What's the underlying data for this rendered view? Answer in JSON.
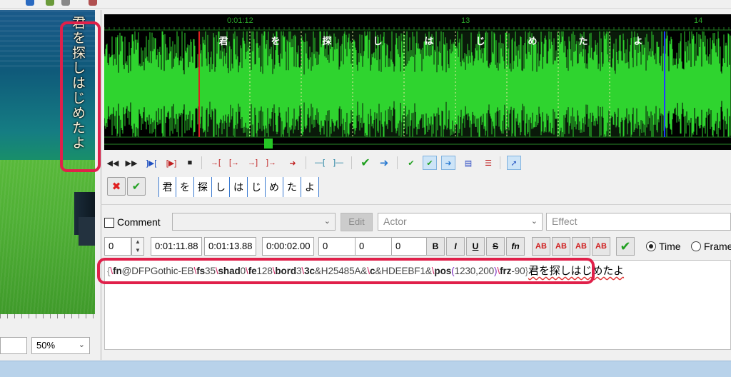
{
  "video": {
    "subtitle_vertical": "君を探しはじめたよ",
    "zoom": "50%"
  },
  "audio": {
    "time_markers": [
      "0:01:12",
      "13",
      "14"
    ],
    "syllables": [
      "君",
      "を",
      "探",
      "し",
      "は",
      "じ",
      "め",
      "た",
      "よ"
    ]
  },
  "karaoke": {
    "cancel_icon": "cancel-icon",
    "accept_icon": "accept-icon",
    "syllables": [
      "君",
      "を",
      "探",
      "し",
      "は",
      "じ",
      "め",
      "た",
      "よ"
    ]
  },
  "editor": {
    "comment_label": "Comment",
    "style_value": "",
    "edit_label": "Edit",
    "actor_placeholder": "Actor",
    "effect_placeholder": "Effect",
    "layer": "0",
    "start_time": "0:01:11.88",
    "end_time": "0:01:13.88",
    "duration": "0:00:02.00",
    "margin_l": "0",
    "margin_r": "0",
    "margin_v": "0",
    "fmt_bold": "B",
    "fmt_italic": "I",
    "fmt_underline": "U",
    "fmt_strike": "S",
    "fmt_font": "fn",
    "color_label": "AB",
    "time_label": "Time",
    "frame_label": "Frame"
  },
  "text": {
    "parts": [
      {
        "c": "br",
        "t": "{"
      },
      {
        "c": "bs",
        "t": "\\"
      },
      {
        "c": "tag",
        "t": "fn"
      },
      {
        "c": "val",
        "t": "@DFPGothic-EB"
      },
      {
        "c": "bs",
        "t": "\\"
      },
      {
        "c": "tag",
        "t": "fs"
      },
      {
        "c": "val",
        "t": "35"
      },
      {
        "c": "bs",
        "t": "\\"
      },
      {
        "c": "tag",
        "t": "shad"
      },
      {
        "c": "val",
        "t": "0"
      },
      {
        "c": "bs",
        "t": "\\"
      },
      {
        "c": "tag",
        "t": "fe"
      },
      {
        "c": "val",
        "t": "128"
      },
      {
        "c": "bs",
        "t": "\\"
      },
      {
        "c": "tag",
        "t": "bord"
      },
      {
        "c": "val",
        "t": "3"
      },
      {
        "c": "bs",
        "t": "\\"
      },
      {
        "c": "tag",
        "t": "3c"
      },
      {
        "c": "val",
        "t": "&H25485A&"
      },
      {
        "c": "bs",
        "t": "\\"
      },
      {
        "c": "tag",
        "t": "c"
      },
      {
        "c": "val",
        "t": "&HDEEBF1&"
      },
      {
        "c": "bs",
        "t": "\\"
      },
      {
        "c": "tag",
        "t": "pos"
      },
      {
        "c": "par",
        "t": "("
      },
      {
        "c": "val",
        "t": "1230,200"
      },
      {
        "c": "par",
        "t": ")"
      },
      {
        "c": "bs",
        "t": "\\"
      },
      {
        "c": "tag",
        "t": "frz"
      },
      {
        "c": "val",
        "t": "-90"
      },
      {
        "c": "br",
        "t": "}"
      },
      {
        "c": "txt",
        "t": "君を探しはじめたよ"
      }
    ]
  },
  "colors": {
    "highlight": "#e0204a",
    "waveform": "#2fd42f",
    "selection_start": "#e02020",
    "selection_end": "#2040ff"
  }
}
